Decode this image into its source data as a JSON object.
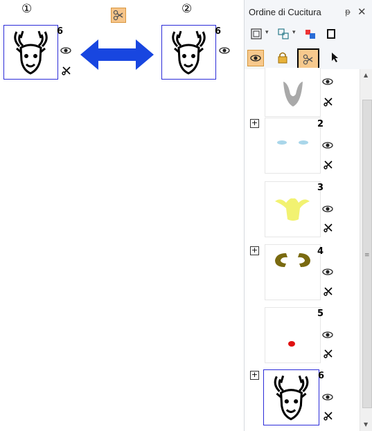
{
  "top": {
    "label_left": "①",
    "label_right": "②",
    "left_count": "6",
    "right_count": "6"
  },
  "panel": {
    "title": "Ordine di Cucitura",
    "pin": "ᵽ",
    "close": "✕"
  },
  "items": [
    {
      "number": ""
    },
    {
      "number": "2"
    },
    {
      "number": "3"
    },
    {
      "number": "4"
    },
    {
      "number": "5"
    },
    {
      "number": "6"
    }
  ],
  "colors": {
    "selection_border": "#2b2bd8",
    "arrow": "#1846e0",
    "item1": "#a9a9a9",
    "item2": "#a9d6ea",
    "item3": "#f2f271",
    "item4": "#7a6a10",
    "item5": "#e01010"
  }
}
